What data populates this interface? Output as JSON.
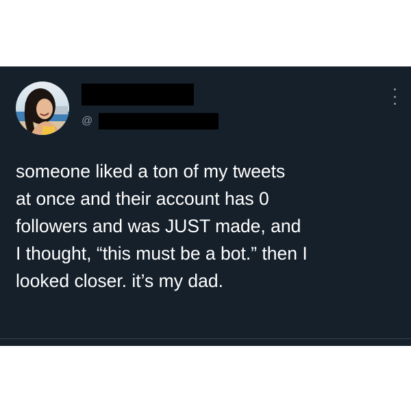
{
  "tweet": {
    "handle_prefix": "@",
    "text_lines": [
      "someone liked a ton of my tweets",
      "at once and their account has 0",
      "followers and was JUST made, and",
      "I thought, “this must be a bot.” then I",
      "looked closer. it’s my dad."
    ]
  },
  "icons": {
    "more": "more-options-icon",
    "avatar": "profile-photo"
  },
  "colors": {
    "background": "#15202b",
    "text": "#ffffff",
    "secondary_text": "#8899a6",
    "redaction": "#000000"
  }
}
